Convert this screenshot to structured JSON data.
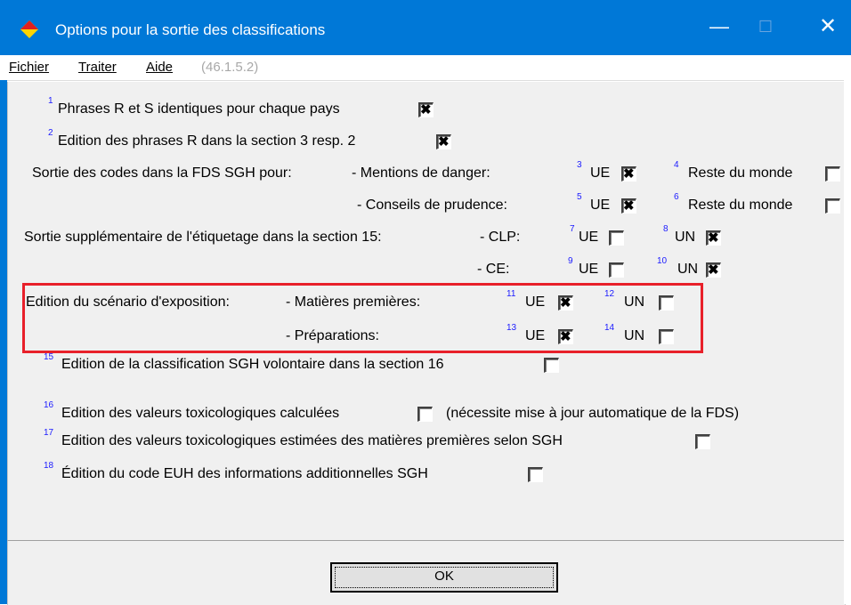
{
  "window": {
    "title": "Options pour la sortie des classifications",
    "min_glyph": "—",
    "max_glyph": "☐",
    "close_glyph": "✕"
  },
  "menu": {
    "items": [
      "Fichier",
      "Traiter",
      "Aide"
    ],
    "version": "(46.1.5.2)"
  },
  "options": {
    "n1": "1",
    "phrases_rs": "Phrases R et S identiques pour chaque pays",
    "n2": "2",
    "edition_r": "Edition des phrases R dans la section 3 resp. 2",
    "sortie_codes": "Sortie des codes dans la FDS SGH pour:",
    "mentions": "- Mentions de danger:",
    "n3": "3",
    "ue": "UE",
    "n4": "4",
    "reste": "Reste du monde",
    "conseils": "- Conseils de prudence:",
    "n5": "5",
    "n6": "6",
    "sortie_supp": "Sortie supplémentaire de l'étiquetage dans la section 15:",
    "clp": "- CLP:",
    "n7": "7",
    "n8": "8",
    "un": "UN",
    "ce": "- CE:",
    "n9": "9",
    "n10": "10",
    "edition_scenario": "Edition du scénario d'exposition:",
    "matieres": "- Matières premières:",
    "n11": "11",
    "n12": "12",
    "preparations": "- Préparations:",
    "n13": "13",
    "n14": "14",
    "n15": "15",
    "sgh_vol": "Edition de la classification SGH volontaire dans la section 16",
    "n16": "16",
    "tox_calc": "Edition des valeurs toxicologiques calculées",
    "tox_note": "(nécessite mise à jour automatique de la FDS)",
    "n17": "17",
    "tox_est": "Edition des valeurs toxicologiques estimées des matières premières selon SGH",
    "n18": "18",
    "euh": "Édition du code EUH des informations additionnelles SGH"
  },
  "checks": {
    "c1": true,
    "c2": true,
    "c3": true,
    "c4": false,
    "c5": true,
    "c6": false,
    "c7": false,
    "c8": true,
    "c9": false,
    "c10": true,
    "c11": true,
    "c12": false,
    "c13": true,
    "c14": false,
    "c15": false,
    "c16": false,
    "c17": false,
    "c18": false
  },
  "footer": {
    "ok_label": "OK"
  },
  "colors": {
    "titlebar": "#0078d7",
    "highlight_box": "#e8202a",
    "footnote": "#1a1aff"
  }
}
